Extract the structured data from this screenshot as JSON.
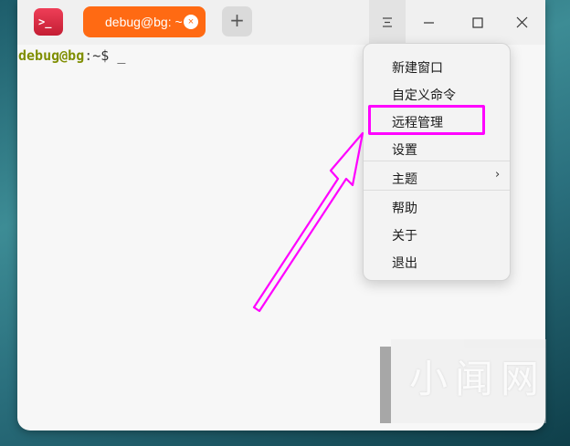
{
  "app": {
    "icon_glyph": ">_",
    "tab_label": "debug@bg: ~",
    "tab_close_glyph": "×",
    "add_tab_glyph": "+",
    "tab_color": "#ff6a13"
  },
  "window_controls": {
    "menu_icon": "hamburger-icon",
    "minimize_icon": "minimize-icon",
    "maximize_icon": "maximize-icon",
    "close_icon": "close-icon"
  },
  "terminal": {
    "user_host": "debug@bg",
    "separator": ":",
    "path": "~$",
    "cursor": "_"
  },
  "menu": {
    "items": [
      {
        "label": "新建窗口"
      },
      {
        "label": "自定义命令"
      },
      {
        "label": "远程管理"
      },
      {
        "label": "设置"
      },
      {
        "label": "主题"
      },
      {
        "label": "帮助"
      },
      {
        "label": "关于"
      },
      {
        "label": "退出"
      }
    ],
    "submenu_chevron": "›",
    "highlight_color": "#ff00ff"
  },
  "watermark": {
    "logo_text": "小闻网"
  }
}
